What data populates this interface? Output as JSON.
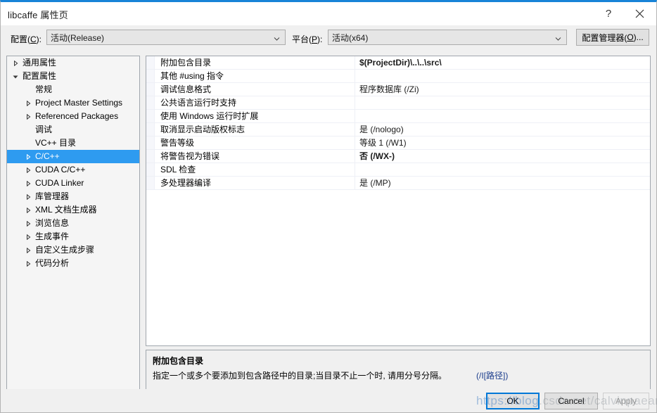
{
  "window": {
    "title": "libcaffe 属性页",
    "help_icon": "?",
    "close_icon": "close-icon"
  },
  "configbar": {
    "config_label_pre": "配置(",
    "config_label_key": "C",
    "config_label_post": "):",
    "config_value": "活动(Release)",
    "platform_label_pre": "平台(",
    "platform_label_key": "P",
    "platform_label_post": "):",
    "platform_value": "活动(x64)",
    "config_manager_pre": "配置管理器(",
    "config_manager_key": "O",
    "config_manager_post": ")..."
  },
  "tree": {
    "items": [
      {
        "label": "通用属性",
        "level": 0,
        "arrow": true,
        "selected": false
      },
      {
        "label": "配置属性",
        "level": 0,
        "arrow": "open",
        "selected": false
      },
      {
        "label": "常规",
        "level": 1,
        "arrow": false,
        "selected": false
      },
      {
        "label": "Project Master Settings",
        "level": 1,
        "arrow": true,
        "selected": false
      },
      {
        "label": "Referenced Packages",
        "level": 1,
        "arrow": true,
        "selected": false
      },
      {
        "label": "调试",
        "level": 1,
        "arrow": false,
        "selected": false
      },
      {
        "label": "VC++ 目录",
        "level": 1,
        "arrow": false,
        "selected": false
      },
      {
        "label": "C/C++",
        "level": 1,
        "arrow": true,
        "selected": true
      },
      {
        "label": "CUDA C/C++",
        "level": 1,
        "arrow": true,
        "selected": false
      },
      {
        "label": "CUDA Linker",
        "level": 1,
        "arrow": true,
        "selected": false
      },
      {
        "label": "库管理器",
        "level": 1,
        "arrow": true,
        "selected": false
      },
      {
        "label": "XML 文档生成器",
        "level": 1,
        "arrow": true,
        "selected": false
      },
      {
        "label": "浏览信息",
        "level": 1,
        "arrow": true,
        "selected": false
      },
      {
        "label": "生成事件",
        "level": 1,
        "arrow": true,
        "selected": false
      },
      {
        "label": "自定义生成步骤",
        "level": 1,
        "arrow": true,
        "selected": false
      },
      {
        "label": "代码分析",
        "level": 1,
        "arrow": true,
        "selected": false
      }
    ]
  },
  "grid": {
    "rows": [
      {
        "name": "附加包含目录",
        "value": "$(ProjectDir)\\..\\..\\src\\",
        "bold": true
      },
      {
        "name": "其他 #using 指令",
        "value": "",
        "bold": false
      },
      {
        "name": "调试信息格式",
        "value": "程序数据库 (/Zi)",
        "bold": false
      },
      {
        "name": "公共语言运行时支持",
        "value": "",
        "bold": false
      },
      {
        "name": "使用 Windows 运行时扩展",
        "value": "",
        "bold": false
      },
      {
        "name": "取消显示启动版权标志",
        "value": "是 (/nologo)",
        "bold": false
      },
      {
        "name": "警告等级",
        "value": "等级 1 (/W1)",
        "bold": false
      },
      {
        "name": "将警告视为错误",
        "value": "否 (/WX-)",
        "bold": true
      },
      {
        "name": "SDL 检查",
        "value": "",
        "bold": false
      },
      {
        "name": "多处理器编译",
        "value": "是 (/MP)",
        "bold": false
      }
    ]
  },
  "description": {
    "title": "附加包含目录",
    "text": "指定一个或多个要添加到包含路径中的目录;当目录不止一个时, 请用分号分隔。",
    "switch": "(/I[路径])"
  },
  "footer": {
    "ok": "OK",
    "cancel": "Cancel",
    "apply": "Apply"
  },
  "watermark": {
    "blue_part": "https://blog",
    "gray_part": ".csdn.net/calvinpaean"
  }
}
